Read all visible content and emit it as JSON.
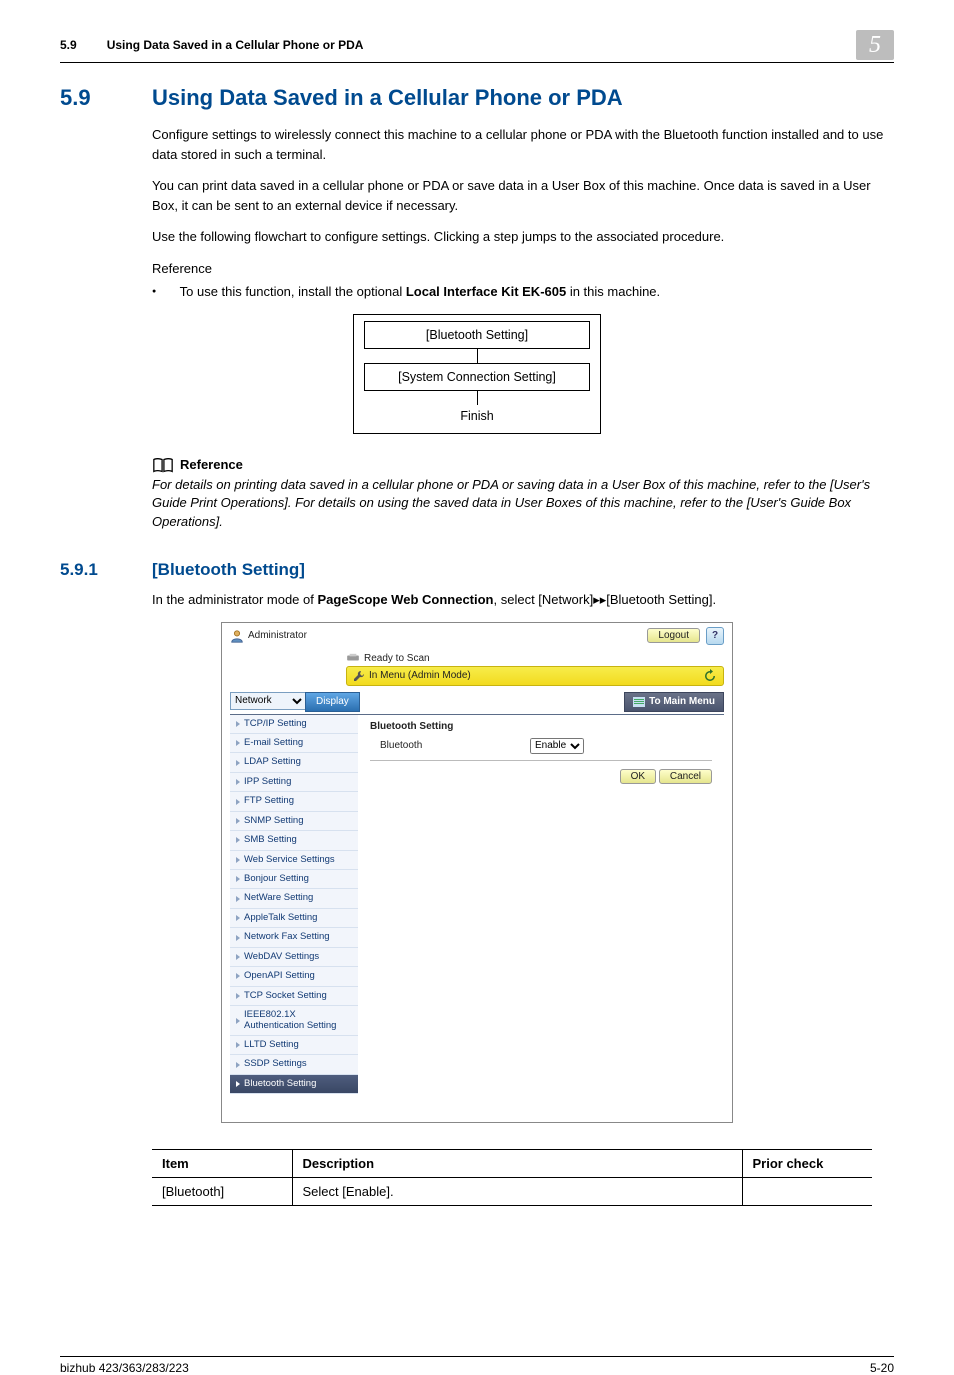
{
  "header": {
    "section_num": "5.9",
    "section_title_running": "Using Data Saved in a Cellular Phone or PDA",
    "chapter_badge": "5"
  },
  "section": {
    "num": "5.9",
    "title": "Using Data Saved in a Cellular Phone or PDA",
    "p1": "Configure settings to wirelessly connect this machine to a cellular phone or PDA with the Bluetooth function installed and to use data stored in such a terminal.",
    "p2": "You can print data saved in a cellular phone or PDA or save data in a User Box of this machine. Once data is saved in a User Box, it can be sent to an external device if necessary.",
    "p3": "Use the following flowchart to configure settings. Clicking a step jumps to the associated procedure.",
    "reference_label": "Reference",
    "bullet_prefix": "To use this function, install the optional ",
    "bullet_bold": "Local Interface Kit EK-605",
    "bullet_suffix": " in this machine."
  },
  "flowchart": {
    "node1": "[Bluetooth Setting]",
    "node2": "[System Connection Setting]",
    "node3": "Finish"
  },
  "reference_block": {
    "label": "Reference",
    "text": "For details on printing data saved in a cellular phone or PDA or saving data in a User Box of this machine, refer to the [User's Guide Print Operations]. For details on using the saved data in User Boxes of this machine, refer to the [User's Guide Box Operations]."
  },
  "subsection": {
    "num": "5.9.1",
    "title": "[Bluetooth Setting]",
    "intro_prefix": "In the administrator mode of ",
    "intro_bold": "PageScope Web Connection",
    "intro_suffix": ", select [Network]▸▸[Bluetooth Setting]."
  },
  "screenshot": {
    "admin_label": "Administrator",
    "logout": "Logout",
    "help": "?",
    "ready": "Ready to Scan",
    "mode": "In Menu (Admin Mode)",
    "select_value": "Network",
    "display": "Display",
    "to_main_menu": "To Main Menu",
    "sidebar": [
      "TCP/IP Setting",
      "E-mail Setting",
      "LDAP Setting",
      "IPP Setting",
      "FTP Setting",
      "SNMP Setting",
      "SMB Setting",
      "Web Service Settings",
      "Bonjour Setting",
      "NetWare Setting",
      "AppleTalk Setting",
      "Network Fax Setting",
      "WebDAV Settings",
      "OpenAPI Setting",
      "TCP Socket Setting",
      "IEEE802.1X Authentication Setting",
      "LLTD Setting",
      "SSDP Settings",
      "Bluetooth Setting"
    ],
    "content_title": "Bluetooth Setting",
    "content_label": "Bluetooth",
    "content_value": "Enable",
    "ok": "OK",
    "cancel": "Cancel"
  },
  "table": {
    "h1": "Item",
    "h2": "Description",
    "h3": "Prior check",
    "r1c1": "[Bluetooth]",
    "r1c2": "Select [Enable].",
    "r1c3": ""
  },
  "footer": {
    "left": "bizhub 423/363/283/223",
    "right": "5-20"
  }
}
